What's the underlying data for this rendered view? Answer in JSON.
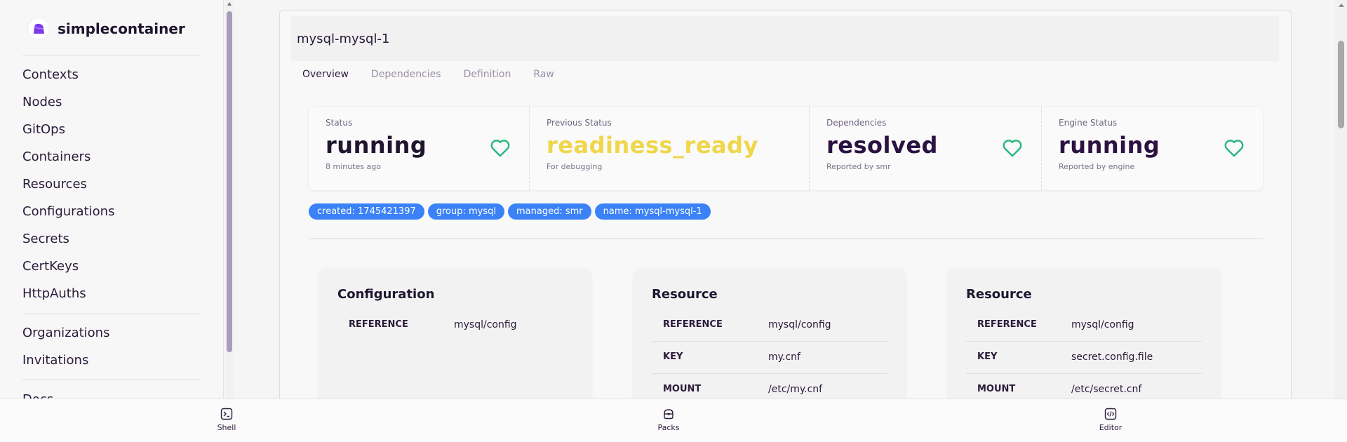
{
  "app": {
    "name": "simplecontainer",
    "brand_color": "#7c3aed"
  },
  "sidebar": {
    "groups": [
      [
        "Contexts",
        "Nodes",
        "GitOps",
        "Containers",
        "Resources",
        "Configurations",
        "Secrets",
        "CertKeys",
        "HttpAuths"
      ],
      [
        "Organizations",
        "Invitations"
      ],
      [
        "Docs"
      ]
    ]
  },
  "main": {
    "title": "mysql-mysql-1",
    "tabs": [
      {
        "label": "Overview",
        "active": true
      },
      {
        "label": "Dependencies",
        "active": false
      },
      {
        "label": "Definition",
        "active": false
      },
      {
        "label": "Raw",
        "active": false
      }
    ],
    "stats": [
      {
        "label": "Status",
        "value": "running",
        "sub": "8 minutes ago",
        "icon": "heart-icon",
        "color": "#20152f"
      },
      {
        "label": "Previous Status",
        "value": "readiness_ready",
        "sub": "For debugging",
        "icon": "",
        "color": "#f0d64a"
      },
      {
        "label": "Dependencies",
        "value": "resolved",
        "sub": "Reported by smr",
        "icon": "heart-icon",
        "color": "#2b1241"
      },
      {
        "label": "Engine Status",
        "value": "running",
        "sub": "Reported by engine",
        "icon": "heart-icon",
        "color": "#2b1241"
      }
    ],
    "heart_color": "#2bb77f",
    "tags": [
      "created: 1745421397",
      "group: mysql",
      "managed: smr",
      "name: mysql-mysql-1"
    ],
    "tag_color": "#3b82f6",
    "cards": [
      {
        "title": "Configuration",
        "rows": [
          {
            "key": "REFERENCE",
            "value": "mysql/config"
          }
        ]
      },
      {
        "title": "Resource",
        "rows": [
          {
            "key": "REFERENCE",
            "value": "mysql/config"
          },
          {
            "key": "KEY",
            "value": "my.cnf"
          },
          {
            "key": "MOUNT",
            "value": "/etc/my.cnf"
          }
        ]
      },
      {
        "title": "Resource",
        "rows": [
          {
            "key": "REFERENCE",
            "value": "mysql/config"
          },
          {
            "key": "KEY",
            "value": "secret.config.file"
          },
          {
            "key": "MOUNT",
            "value": "/etc/secret.cnf"
          }
        ]
      }
    ]
  },
  "dock": {
    "items": [
      {
        "label": "Shell",
        "icon": "terminal-icon"
      },
      {
        "label": "Packs",
        "icon": "package-icon"
      },
      {
        "label": "Editor",
        "icon": "code-icon"
      }
    ]
  }
}
